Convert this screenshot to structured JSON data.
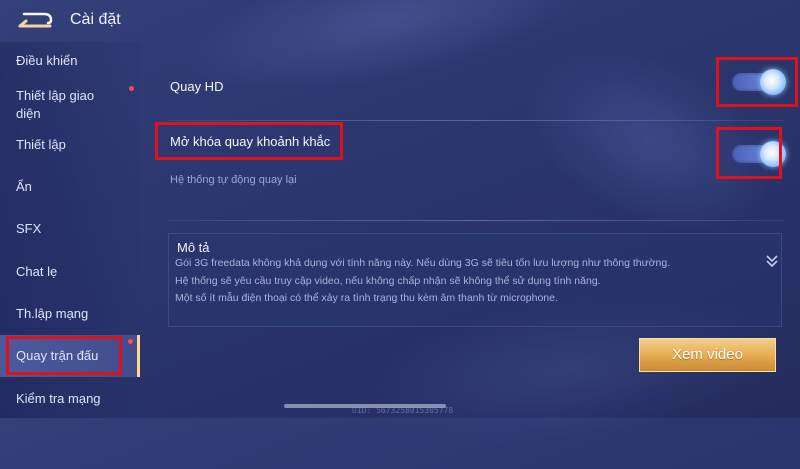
{
  "header": {
    "title": "Cài đặt"
  },
  "sidebar": {
    "items": [
      {
        "label": "Điều khiển"
      },
      {
        "label": "Thiết lập giao\ndiện"
      },
      {
        "label": "Thiết lập"
      },
      {
        "label": "Ẩn"
      },
      {
        "label": "SFX"
      },
      {
        "label": "Chat lẹ"
      },
      {
        "label": "Th.lập mạng"
      },
      {
        "label": "Quay trận đấu"
      },
      {
        "label": "Kiểm tra mạng"
      }
    ],
    "active_item": "Quay trận đấu"
  },
  "settings": {
    "quay_hd": {
      "label": "Quay HD",
      "enabled": true
    },
    "mo_khoa": {
      "label": "Mở khóa quay khoảnh khắc",
      "enabled": true,
      "hint": "Hệ thống tự động quay lại"
    }
  },
  "description": {
    "title": "Mô tả",
    "lines": [
      "Gói 3G freedata không khả dụng với tính năng này. Nếu dùng 3G sẽ tiêu tốn lưu lượng như thông thường.",
      "Hệ thống sẽ yêu cầu truy cập video, nếu không chấp nhận sẽ không thể sử dụng tính năng.",
      "Một số ít mẫu điện thoại có thể xảy ra tình trạng thu kèm âm thanh từ microphone."
    ]
  },
  "buttons": {
    "view_video": "Xem video"
  },
  "footer": {
    "uid": "UID: 5673258015305778"
  },
  "colors": {
    "highlight_box": "#e0111b",
    "button_gold": "#e6a94d",
    "background": "#2c3770"
  }
}
